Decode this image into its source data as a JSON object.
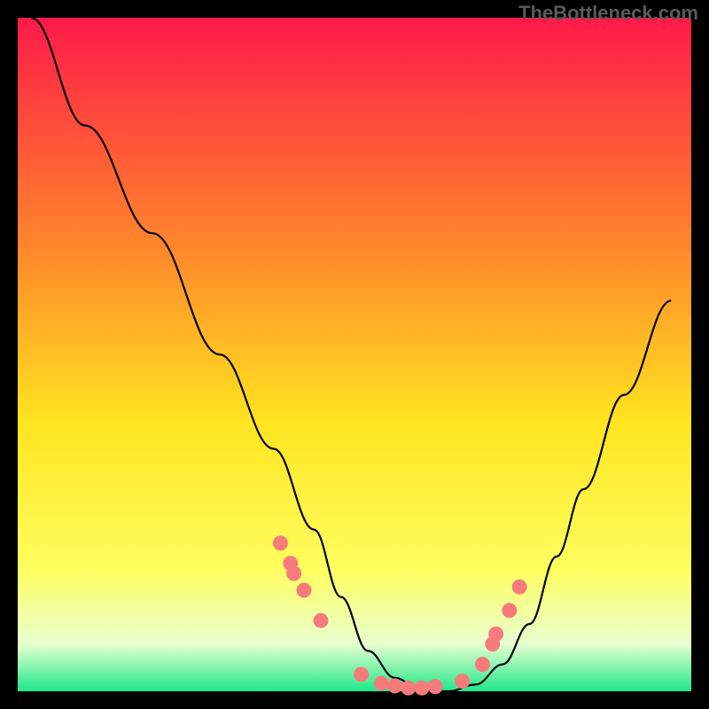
{
  "watermark": "TheBottleneck.com",
  "chart_data": {
    "type": "line",
    "title": "",
    "xlabel": "",
    "ylabel": "",
    "xlim": [
      0,
      100
    ],
    "ylim": [
      0,
      100
    ],
    "gradient_colors": {
      "top": "#ff1a49",
      "upper_mid": "#ff8a2a",
      "mid": "#ffe420",
      "lower_mid": "#ffff60",
      "bottom": "#1ee88a"
    },
    "series": [
      {
        "name": "bottleneck-curve",
        "x": [
          2,
          10,
          20,
          30,
          38,
          44,
          48,
          52,
          56,
          60,
          64,
          68,
          72,
          76,
          80,
          84,
          90,
          97
        ],
        "y": [
          100,
          84,
          68,
          50,
          36,
          24,
          14,
          6,
          2,
          0,
          0,
          1,
          4,
          10,
          20,
          30,
          44,
          58
        ]
      }
    ],
    "marker_points": {
      "name": "highlighted-points",
      "color": "#f77b7b",
      "x": [
        39.0,
        40.5,
        41.0,
        42.5,
        45.0,
        51.0,
        54.0,
        56.0,
        58.0,
        60.0,
        62.0,
        66.0,
        69.0,
        70.5,
        71.0,
        73.0,
        74.5
      ],
      "y": [
        22.0,
        19.0,
        17.5,
        15.0,
        10.5,
        2.5,
        1.2,
        0.8,
        0.5,
        0.5,
        0.7,
        1.5,
        4.0,
        7.0,
        8.5,
        12.0,
        15.5
      ]
    }
  }
}
